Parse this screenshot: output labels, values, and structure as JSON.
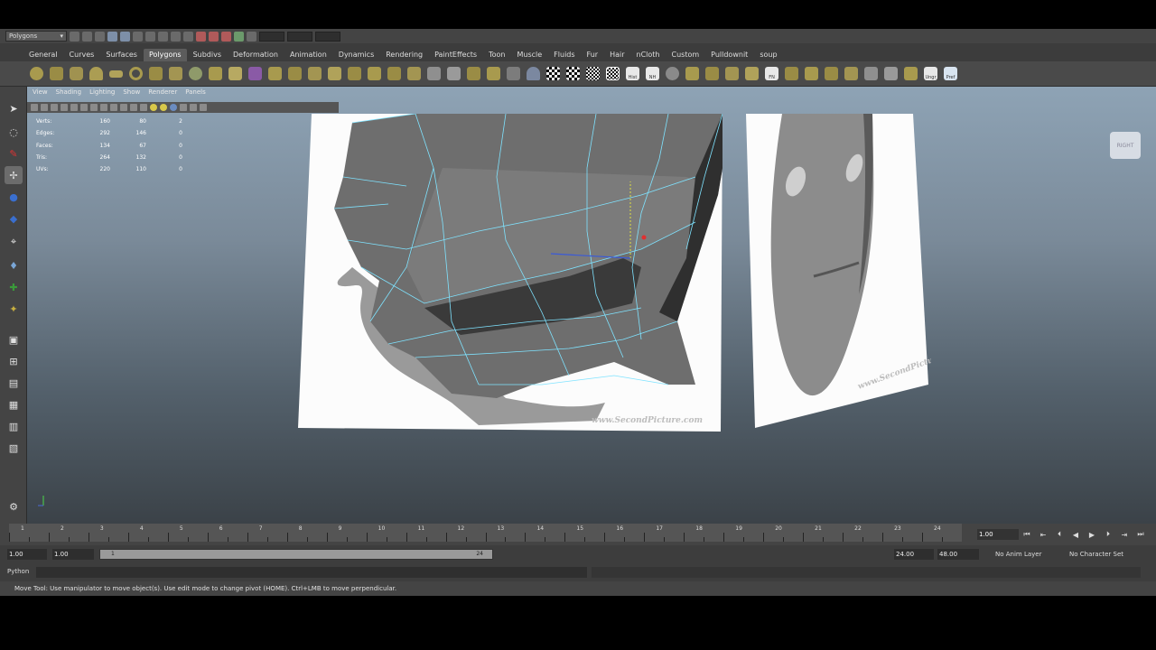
{
  "status_line": {
    "mode": "Polygons"
  },
  "shelf_tabs": [
    "General",
    "Curves",
    "Surfaces",
    "Polygons",
    "Subdivs",
    "Deformation",
    "Animation",
    "Dynamics",
    "Rendering",
    "PaintEffects",
    "Toon",
    "Muscle",
    "Fluids",
    "Fur",
    "Hair",
    "nCloth",
    "Custom",
    "Pulldownit",
    "soup"
  ],
  "active_shelf_tab": "Polygons",
  "shelf_icon_labels": {
    "hist": "Hist",
    "nh": "NH",
    "fn": "FN",
    "ungr": "Ungr",
    "pref": "Pref"
  },
  "viewport_menu": [
    "View",
    "Shading",
    "Lighting",
    "Show",
    "Renderer",
    "Panels"
  ],
  "hud": [
    {
      "label": "Verts:",
      "a": "160",
      "b": "80",
      "c": "2"
    },
    {
      "label": "Edges:",
      "a": "292",
      "b": "146",
      "c": "0"
    },
    {
      "label": "Faces:",
      "a": "134",
      "b": "67",
      "c": "0"
    },
    {
      "label": "Tris:",
      "a": "264",
      "b": "132",
      "c": "0"
    },
    {
      "label": "UVs:",
      "a": "220",
      "b": "110",
      "c": "0"
    }
  ],
  "viewcube_label": "RIGHT",
  "watermark": "www.SecondPicture.com",
  "time_slider": {
    "ticks": [
      "1",
      "2",
      "3",
      "4",
      "5",
      "6",
      "7",
      "8",
      "9",
      "10",
      "11",
      "12",
      "13",
      "14",
      "15",
      "16",
      "17",
      "18",
      "19",
      "20",
      "21",
      "22",
      "23",
      "24"
    ],
    "current_frame": "1.00"
  },
  "range_slider": {
    "start": "1.00",
    "playback_start": "1.00",
    "range_start_label": "1",
    "range_end_label": "24",
    "playback_end": "24.00",
    "end": "48.00",
    "anim_layer": "No Anim Layer",
    "character_set": "No Character Set"
  },
  "command_line": {
    "label": "Python"
  },
  "help_line": "Move Tool: Use manipulator to move object(s). Use edit mode to change pivot (HOME). Ctrl+LMB to move perpendicular."
}
